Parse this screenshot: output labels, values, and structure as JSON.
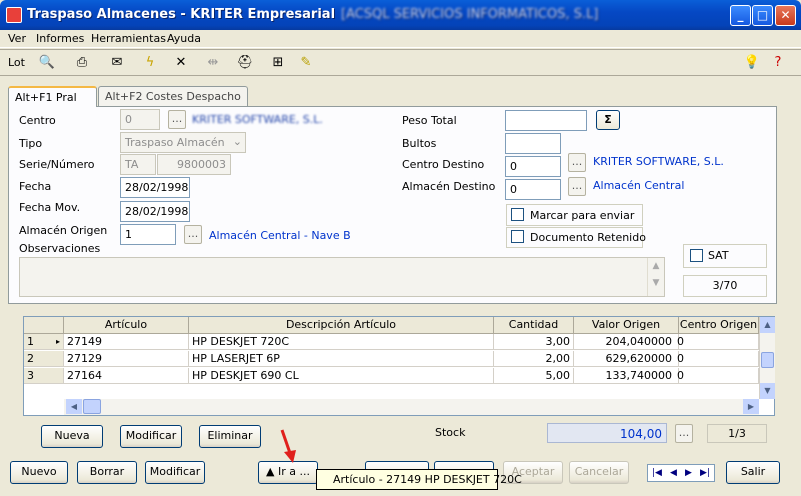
{
  "window": {
    "title": "Traspaso Almacenes - KRITER Empresarial",
    "title_blurred": "[ACSQL SERVICIOS INFORMATICOS, S.L]",
    "min": "_",
    "max": "□",
    "close": "✕"
  },
  "menu": [
    "Ver",
    "Informes",
    "Herramientas",
    "Ayuda"
  ],
  "toolbar": {
    "lot": "Lot",
    "right_icons": [
      "lightbulb-icon",
      "help-icon"
    ]
  },
  "tabs": [
    "Alt+F1 Pral",
    "Alt+F2 Costes Despacho"
  ],
  "form": {
    "centro_label": "Centro",
    "centro_value": "0",
    "centro_name": "KRITER SOFTWARE, S.L.",
    "tipo_label": "Tipo",
    "tipo_value": "Traspaso Almacén",
    "serie_label": "Serie/Número",
    "serie_value": "TA",
    "numero_value": "9800003",
    "fecha_label": "Fecha",
    "fecha_value": "28/02/1998",
    "fechamov_label": "Fecha Mov.",
    "fechamov_value": "28/02/1998",
    "almorig_label": "Almacén Origen",
    "almorig_value": "1",
    "almorig_name": "Almacén Central - Nave B",
    "obs_label": "Observaciones",
    "peso_label": "Peso Total",
    "sigma": "Σ",
    "bultos_label": "Bultos",
    "centrodest_label": "Centro Destino",
    "centrodest_value": "0",
    "centrodest_name": "KRITER SOFTWARE, S.L.",
    "almdest_label": "Almacén Destino",
    "almdest_value": "0",
    "almdest_name": "Almacén Central",
    "marcar_label": "Marcar para enviar",
    "retenido_label": "Documento Retenido",
    "sat_label": "SAT",
    "counter": "3/70",
    "dots": "..."
  },
  "grid": {
    "headers": [
      "Artículo",
      "Descripción Artículo",
      "Cantidad",
      "Valor Origen",
      "Centro Origen"
    ],
    "rows": [
      [
        "1",
        "27149",
        "HP DESKJET 720C",
        "3,00",
        "204,040000",
        "0"
      ],
      [
        "2",
        "27129",
        "HP LASERJET 6P",
        "2,00",
        "629,620000",
        "0"
      ],
      [
        "3",
        "27164",
        "HP DESKJET 690 CL",
        "5,00",
        "133,740000",
        "0"
      ]
    ]
  },
  "lines_buttons": {
    "nueva": "Nueva",
    "modificar": "Modificar",
    "eliminar": "Eliminar"
  },
  "stock": {
    "label": "Stock",
    "value": "104,00",
    "page": "1/3"
  },
  "bottom": {
    "nuevo": "Nuevo",
    "borrar": "Borrar",
    "modificar": "Modificar",
    "ir": "▲ Ir a ...",
    "aceptar": "Aceptar",
    "cancelar": "Cancelar",
    "salir": "Salir",
    "nav": [
      "|◀",
      "◀",
      "▶",
      "▶|"
    ]
  },
  "tooltip": "Artículo - 27149 HP DESKJET 720C",
  "colors": {
    "title_bar": "#0548c4",
    "accent_blue": "#0033cc",
    "tab_highlight": "#f4b844",
    "arrow": "#e0201c"
  }
}
